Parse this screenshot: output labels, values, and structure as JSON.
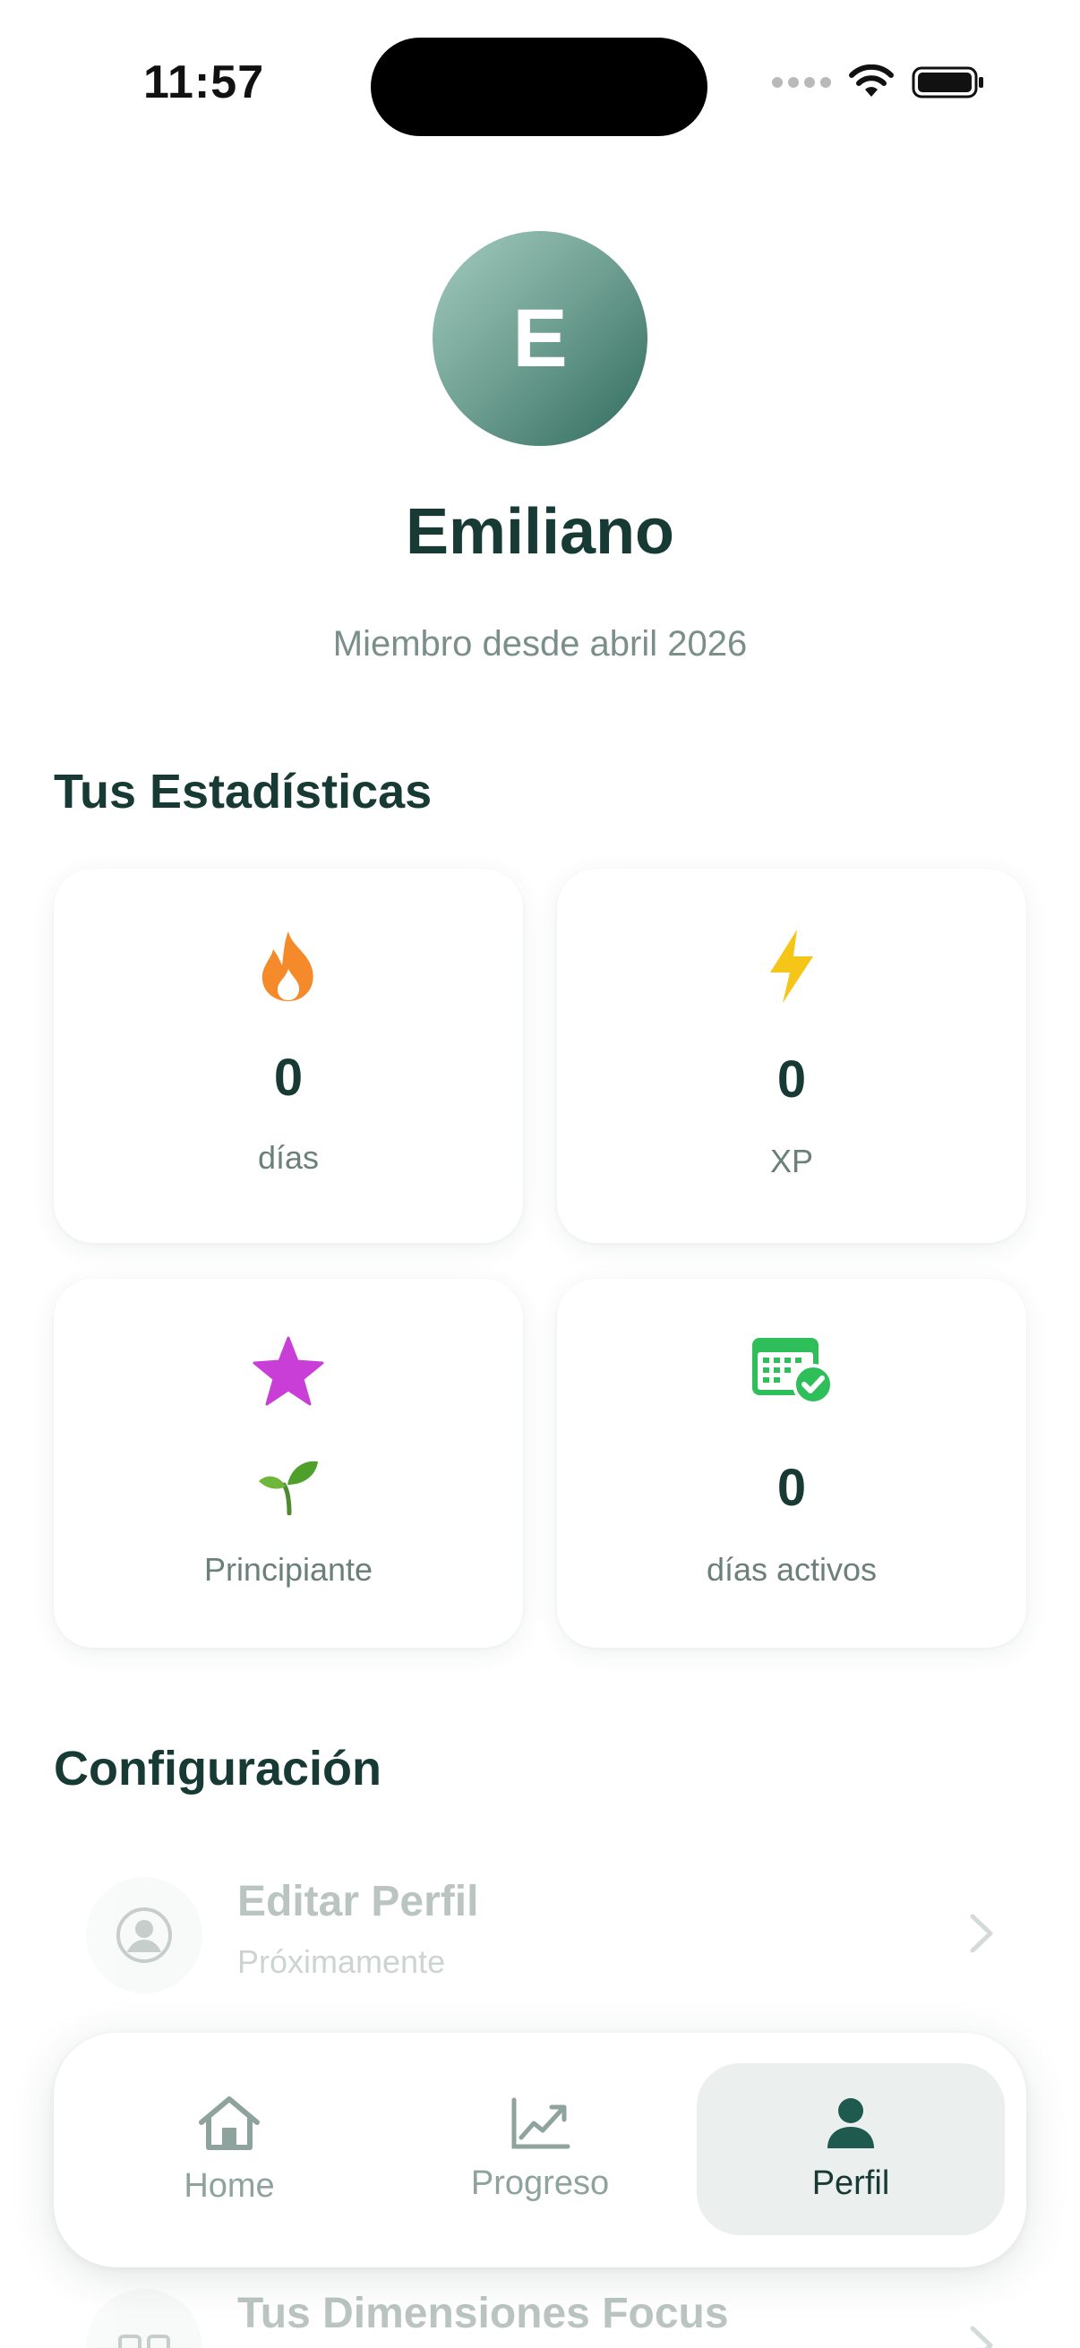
{
  "status_bar": {
    "time": "11:57"
  },
  "profile": {
    "avatar_initial": "E",
    "name": "Emiliano",
    "member_since": "Miembro desde abril 2026"
  },
  "stats": {
    "title": "Tus Estadísticas",
    "cards": [
      {
        "icon": "flame-icon",
        "value": "0",
        "label": "días"
      },
      {
        "icon": "lightning-icon",
        "value": "0",
        "label": "XP"
      },
      {
        "icon": "star-icon",
        "value_icon": "sprout-icon",
        "label": "Principiante"
      },
      {
        "icon": "calendar-check-icon",
        "value": "0",
        "label": "días activos"
      }
    ]
  },
  "settings": {
    "title": "Configuración",
    "items": [
      {
        "icon": "user-circle-icon",
        "title": "Editar Perfil",
        "subtitle": "Próximamente"
      },
      {
        "icon": "grid-icon",
        "title": "Tus Dimensiones Focus"
      }
    ]
  },
  "tab_bar": {
    "tabs": [
      {
        "icon": "home-icon",
        "label": "Home"
      },
      {
        "icon": "chart-line-icon",
        "label": "Progreso"
      },
      {
        "icon": "person-icon",
        "label": "Perfil",
        "active": true
      }
    ]
  },
  "colors": {
    "primary_dark": "#173a34",
    "muted_text": "#7a8f8a",
    "flame": "#f58a2a",
    "lightning": "#f5c518",
    "star": "#c93ed6",
    "calendar": "#2fbf5a",
    "tab_active_bg": "#ebf0ee"
  }
}
